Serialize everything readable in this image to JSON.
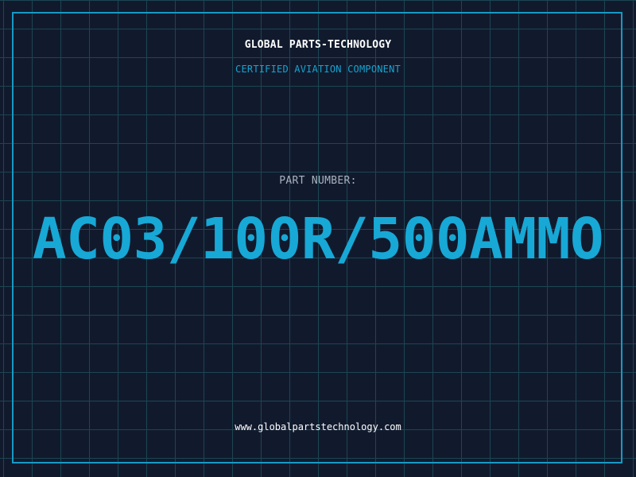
{
  "header": {
    "company_name": "GLOBAL PARTS-TECHNOLOGY",
    "tagline": "CERTIFIED AVIATION COMPONENT"
  },
  "part": {
    "label": "PART NUMBER:",
    "number": "AC03/100R/500AMMO"
  },
  "footer": {
    "website": "www.globalpartstechnology.com"
  },
  "colors": {
    "background": "#111a2d",
    "grid": "#1c4553",
    "accent": "#17a8d6",
    "text_primary": "#ffffff",
    "text_muted": "#a9b2bd"
  }
}
